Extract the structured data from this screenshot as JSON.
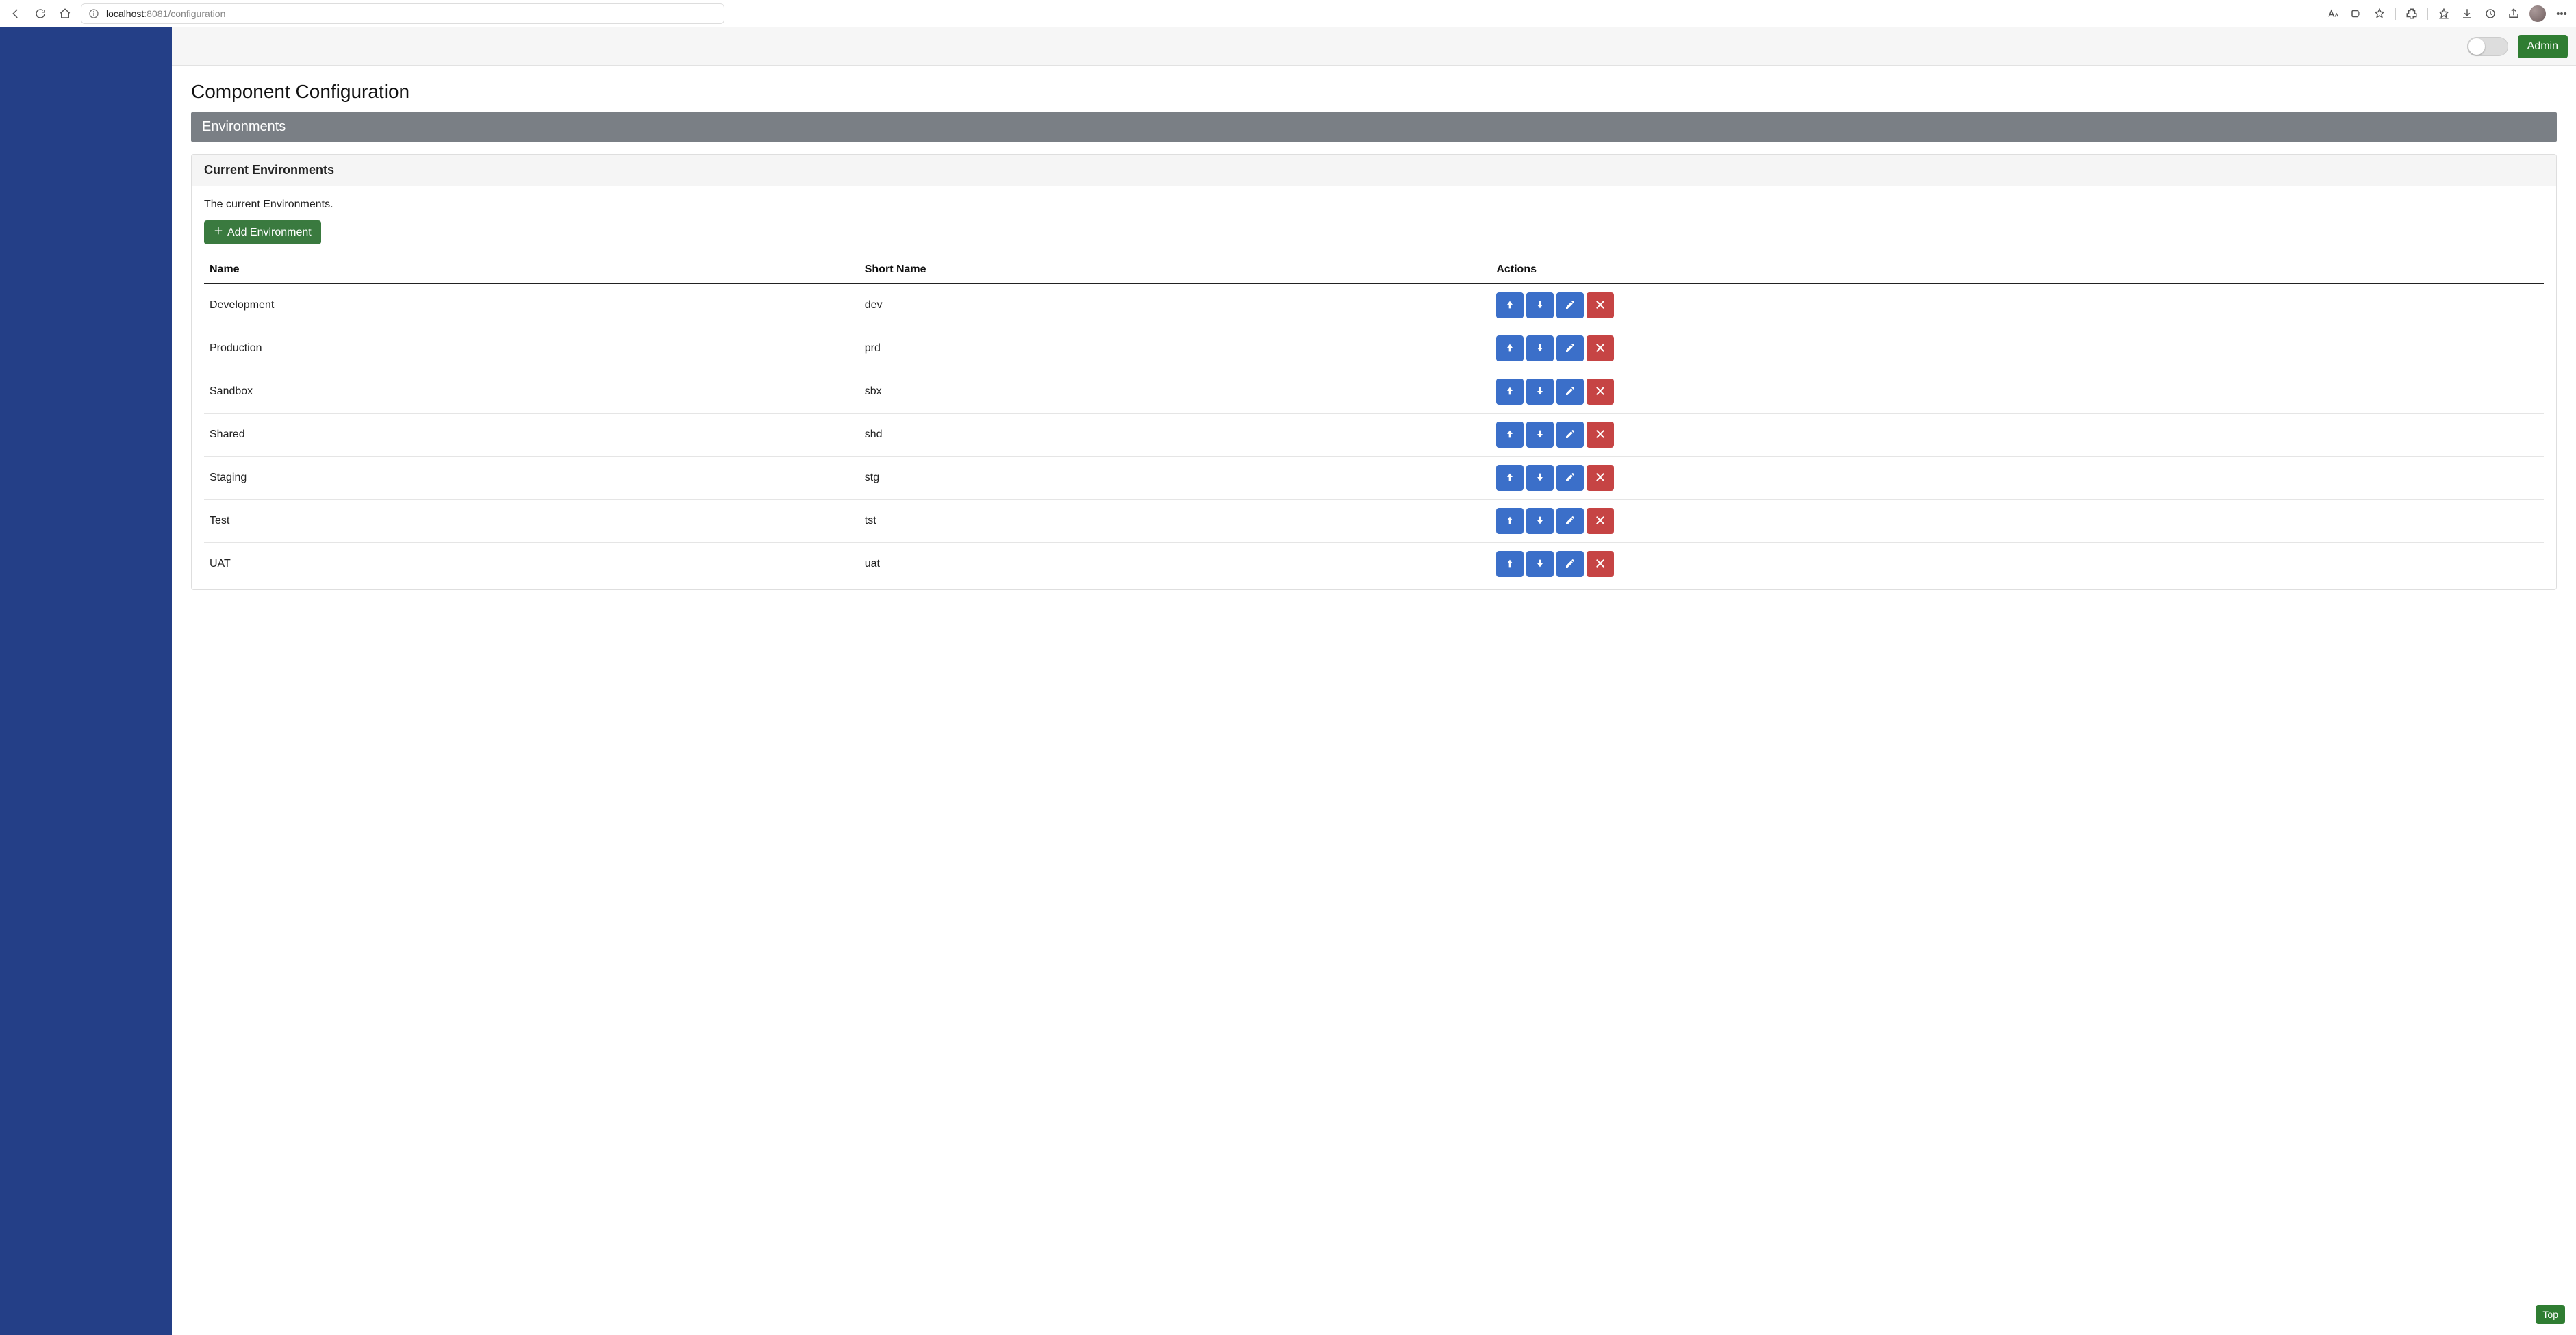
{
  "browser": {
    "url_host": "localhost",
    "url_port": ":8081",
    "url_path": "/configuration"
  },
  "header": {
    "admin_label": "Admin"
  },
  "page": {
    "title": "Component Configuration",
    "section_title": "Environments"
  },
  "card": {
    "title": "Current Environments",
    "description": "The current Environments.",
    "add_label": "Add Environment"
  },
  "table": {
    "columns": {
      "name": "Name",
      "short": "Short Name",
      "actions": "Actions"
    },
    "rows": [
      {
        "name": "Development",
        "short": "dev"
      },
      {
        "name": "Production",
        "short": "prd"
      },
      {
        "name": "Sandbox",
        "short": "sbx"
      },
      {
        "name": "Shared",
        "short": "shd"
      },
      {
        "name": "Staging",
        "short": "stg"
      },
      {
        "name": "Test",
        "short": "tst"
      },
      {
        "name": "UAT",
        "short": "uat"
      }
    ]
  },
  "footer": {
    "top_label": "Top"
  }
}
